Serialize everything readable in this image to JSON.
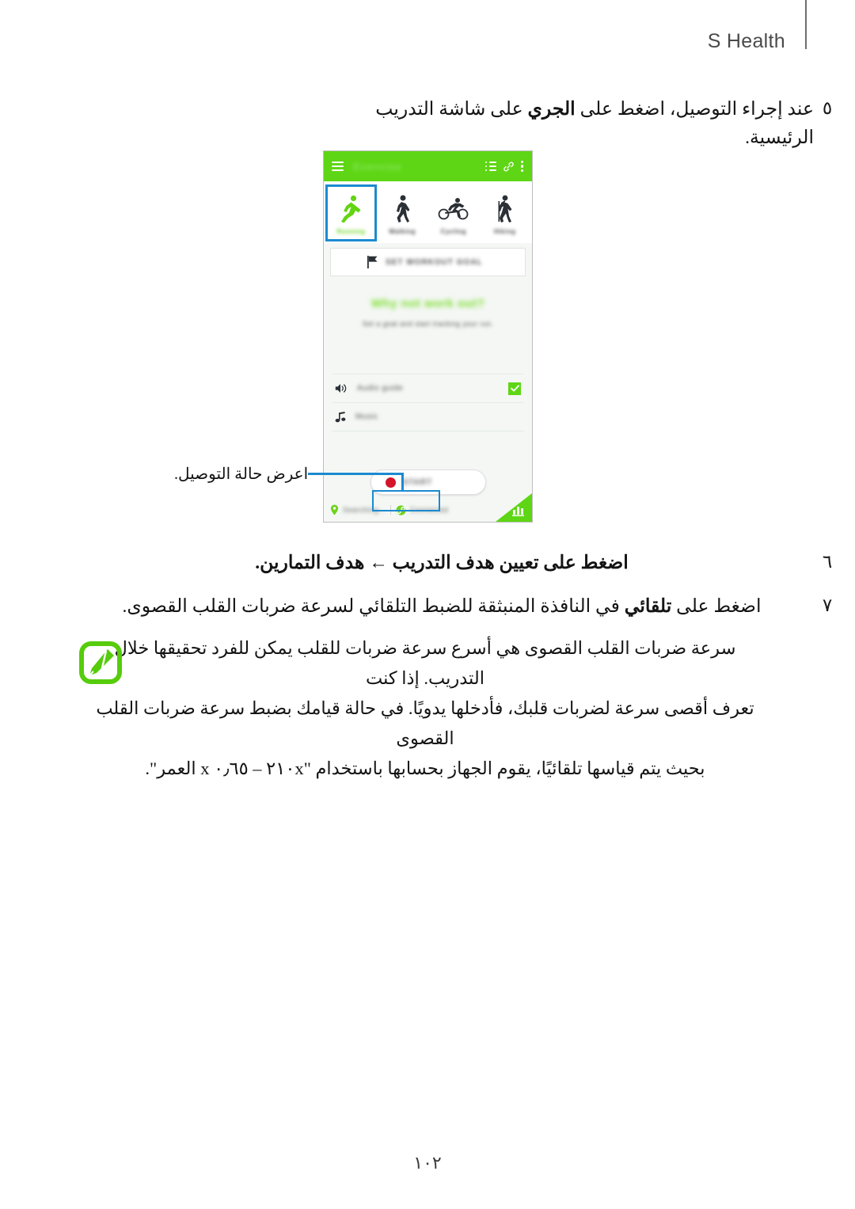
{
  "header": {
    "title": "S Health"
  },
  "steps": [
    {
      "number": "٥",
      "id": "step5",
      "text_parts": [
        {
          "t": "عند إجراء التوصيل، اضغط على ",
          "b": false
        },
        {
          "t": "الجري",
          "b": true
        },
        {
          "t": " على شاشة التدريب الرئيسية.",
          "b": false
        }
      ],
      "text": "عند إجراء التوصيل، اضغط على الجري على شاشة التدريب الرئيسية."
    },
    {
      "number": "٦",
      "id": "step6",
      "text": "اضغط على تعيين هدف التدريب ← هدف التمارين."
    },
    {
      "number": "٧",
      "id": "step7",
      "text_parts": [
        {
          "t": "اضغط على ",
          "b": false
        },
        {
          "t": "تلقائي",
          "b": true
        },
        {
          "t": " في النافذة المنبثقة للضبط التلقائي لسرعة ضربات القلب القصوى.",
          "b": false
        }
      ],
      "text": "اضغط على تلقائي في النافذة المنبثقة للضبط التلقائي لسرعة ضربات القلب القصوى."
    }
  ],
  "note": {
    "icon_name": "note-pencil-icon",
    "icon_color": "#56cc0c",
    "lines": [
      "سرعة ضربات القلب القصوى هي أسرع سرعة ضربات للقلب يمكن للفرد تحقيقها خلال التدريب. إذا كنت",
      "تعرف أقصى سرعة لضربات قلبك، فأدخلها يدويًا. في حالة قيامك بضبط سرعة ضربات القلب القصوى",
      "بحيث يتم قياسها تلقائيًا، يقوم الجهاز بحسابها باستخدام \"٢١٠x – ٠٫٦٥ x العمر\"."
    ]
  },
  "page_number": "١٠٢",
  "callout": {
    "label": "اعرض حالة التوصيل.",
    "accent_color": "#1b8ad0"
  },
  "phone": {
    "app_bar": {
      "menu_icon": "hamburger-icon",
      "title": "Exercise",
      "list_icon": "list-icon",
      "link_icon": "link-icon",
      "overflow_icon": "more-vertical-icon",
      "background": "#5ed615"
    },
    "activities": [
      {
        "label": "Running",
        "icon": "running-icon",
        "selected": true
      },
      {
        "label": "Walking",
        "icon": "walking-icon",
        "selected": false
      },
      {
        "label": "Cycling",
        "icon": "cycling-icon",
        "selected": false
      },
      {
        "label": "Hiking",
        "icon": "hiking-icon",
        "selected": false
      }
    ],
    "goal_card": {
      "icon": "flag-icon",
      "label": "SET WORKOUT GOAL"
    },
    "promo": {
      "title": "Why not work out?",
      "subtitle": "Set a goal and start tracking your run.",
      "title_color": "#7ade2a"
    },
    "options": [
      {
        "icon": "speaker-icon",
        "label": "Audio guide",
        "checked": true
      },
      {
        "icon": "music-note-icon",
        "label": "Music",
        "checked": false
      }
    ],
    "start_button": {
      "icon": "record-dot-icon",
      "label": "START",
      "dot_color": "#d4142a"
    },
    "status": {
      "location": {
        "icon": "location-pin-icon",
        "label": "Searching..."
      },
      "connection": {
        "icon": "connected-link-icon",
        "label": "Connected"
      }
    },
    "corner_badge": {
      "icon": "bar-chart-icon",
      "color": "#5ed615"
    }
  }
}
